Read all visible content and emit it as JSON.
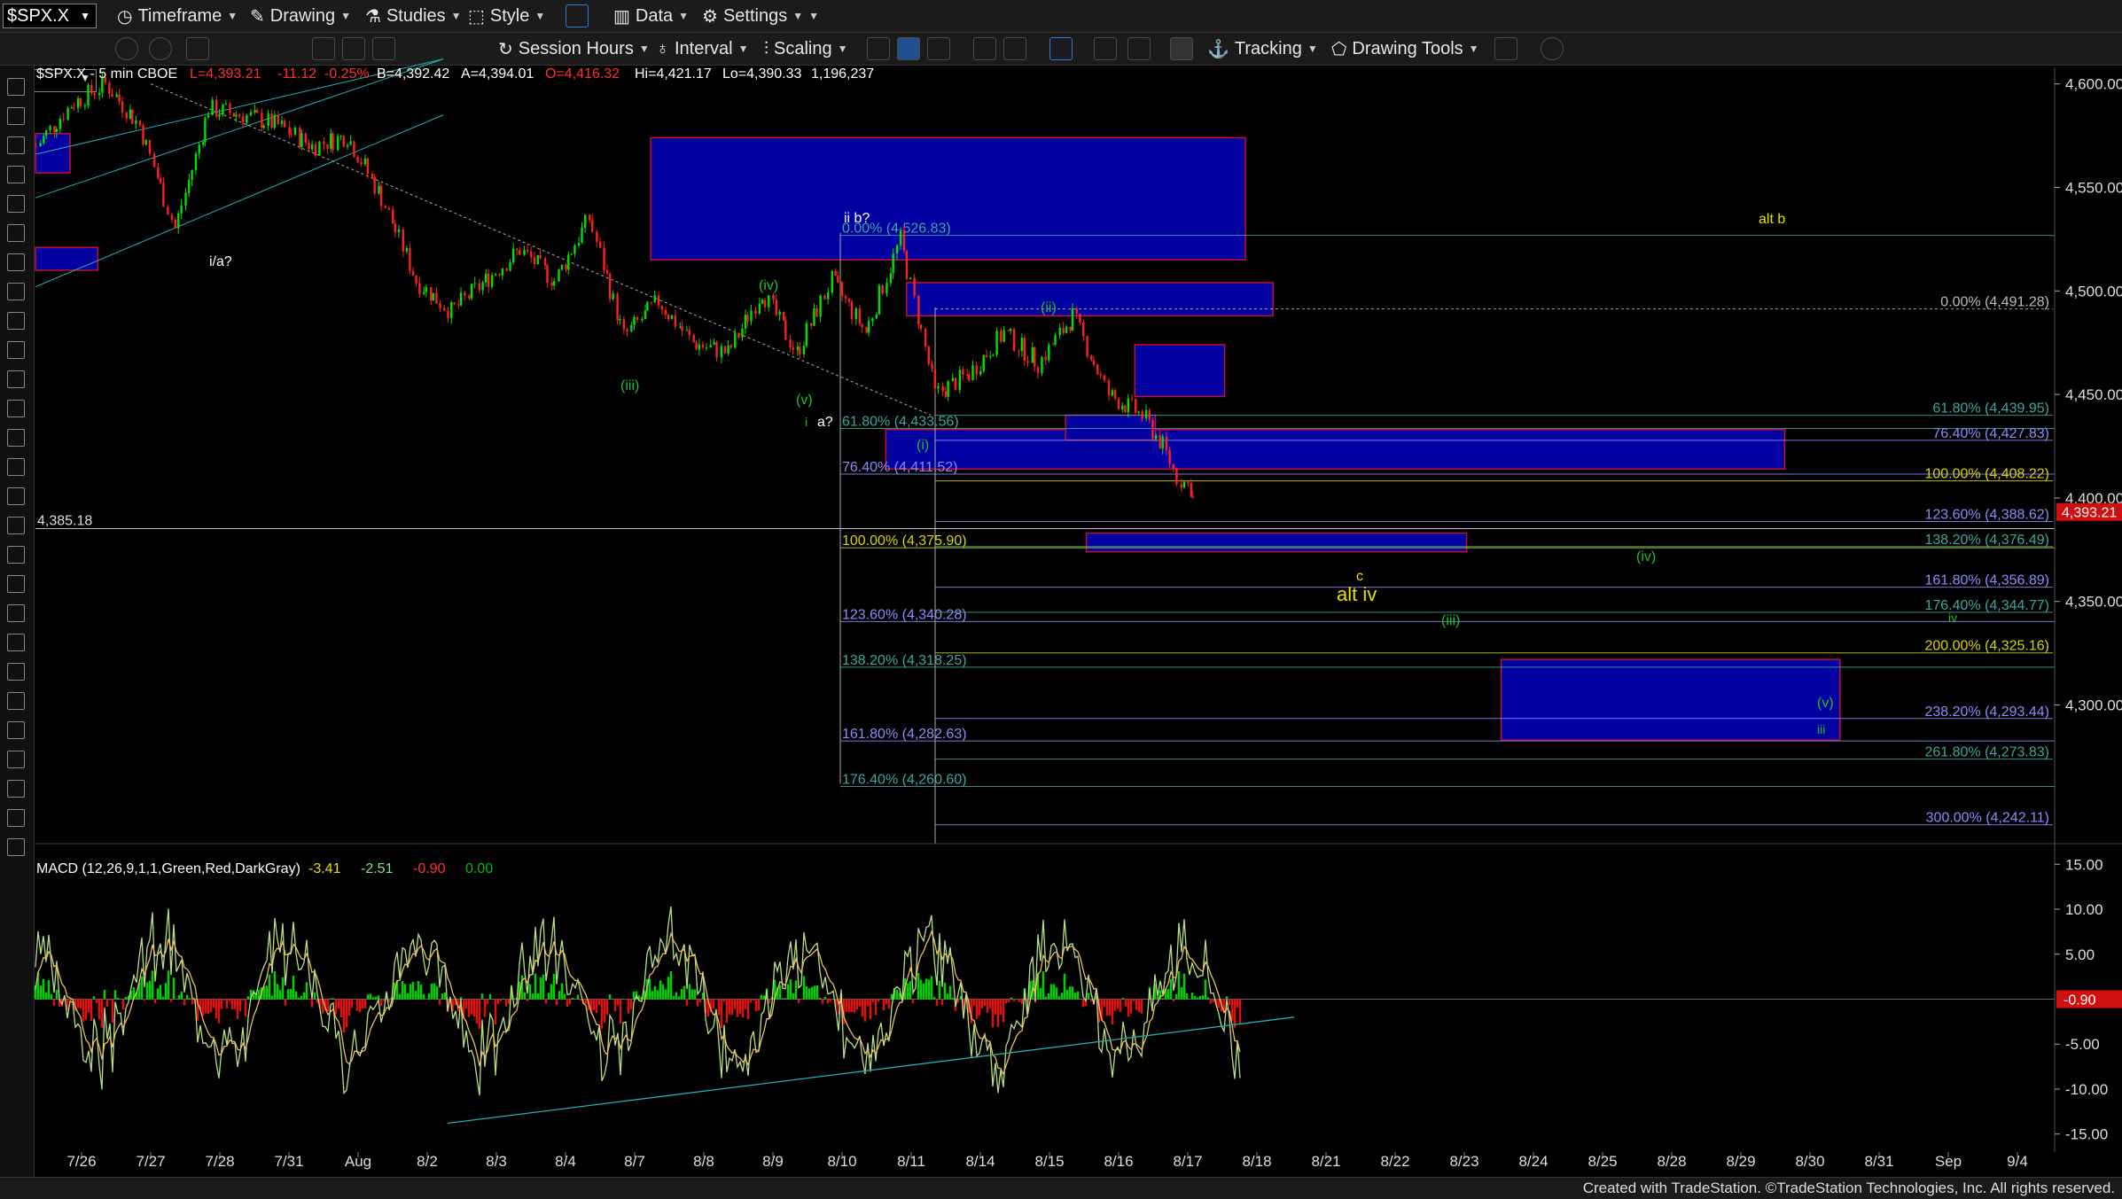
{
  "toolbar": {
    "symbol": "$SPX.X",
    "timeframe": "Timeframe",
    "drawing": "Drawing",
    "studies": "Studies",
    "style": "Style",
    "data": "Data",
    "settings": "Settings",
    "session_hours": "Session Hours",
    "interval": "Interval",
    "scaling": "Scaling",
    "tracking": "Tracking",
    "drawing_tools": "Drawing Tools"
  },
  "header": {
    "symbol_info": "$SPX.X - 5 min  CBOE",
    "last": "L=4,393.21",
    "change": "-11.12",
    "change_pct": "-0.25%",
    "bid": "B=4,392.42",
    "ask": "A=4,394.01",
    "open": "O=4,416.32",
    "high": "Hi=4,421.17",
    "low": "Lo=4,390.33",
    "volume": "1,196,237"
  },
  "colors": {
    "up": "#00e000",
    "down": "#ff2020",
    "box_fill": "#0000a0",
    "box_stroke": "#c0103a",
    "label_green": "#22c022",
    "label_yellow": "#e8e000",
    "fib_blue": "#8c8cff",
    "fib_teal": "#3aa89a",
    "fib_yellow": "#d6d600",
    "trend": "#20b0b0"
  },
  "chart_data": [
    {
      "type": "line",
      "title": "$SPX.X - 5 min",
      "x_ticks": [
        "7/26",
        "7/27",
        "7/28",
        "7/31",
        "Aug",
        "8/2",
        "8/3",
        "8/4",
        "8/7",
        "8/8",
        "8/9",
        "8/10",
        "8/11",
        "8/14",
        "8/15",
        "8/16",
        "8/17",
        "8/18",
        "8/21",
        "8/22",
        "8/23",
        "8/24",
        "8/25",
        "8/28",
        "8/29",
        "8/30",
        "8/31",
        "Sep",
        "9/4"
      ],
      "y_ticks": [
        "4,600.00",
        "4,550.00",
        "4,500.00",
        "4,450.00",
        "4,400.00",
        "4,350.00",
        "4,300.00"
      ],
      "ylim": [
        4233,
        4608
      ],
      "last_price": "4,393.21",
      "hline": "4,385.18",
      "x": [
        0,
        0.5,
        1,
        1.5,
        2,
        2.5,
        3,
        3.5,
        4,
        4.5,
        5,
        5.5,
        6,
        6.5,
        7,
        7.5,
        8,
        8.5,
        9,
        9.5,
        10,
        10.5,
        11,
        11.5,
        12,
        12.5,
        13,
        13.5,
        14,
        14.5,
        15,
        15.5,
        16,
        16.3,
        16.5,
        16.7,
        16.75
      ],
      "values": [
        4570,
        4590,
        4600,
        4580,
        4530,
        4588,
        4585,
        4580,
        4570,
        4575,
        4545,
        4505,
        4490,
        4505,
        4520,
        4505,
        4535,
        4478,
        4495,
        4475,
        4470,
        4500,
        4470,
        4505,
        4480,
        4525,
        4450,
        4460,
        4480,
        4465,
        4488,
        4450,
        4440,
        4425,
        4410,
        4405,
        4393
      ],
      "wave_labels": [
        "i/a?",
        "ii b?",
        "(iv)",
        "(iii)",
        "(v)",
        "i",
        "a?",
        "(i)",
        "(ii)",
        "(iv)",
        "(iii)",
        "c",
        "alt iv",
        "alt b",
        "(v)",
        "iii",
        "iv"
      ],
      "fib_labels": [
        "0.00% (4,526.83)",
        "61.80% (4,433.56)",
        "76.40% (4,411.52)",
        "100.00% (4,375.90)",
        "123.60% (4,340.28)",
        "138.20% (4,318.25)",
        "161.80% (4,282.63)",
        "176.40% (4,260.60)",
        "0.00% (4,491.28)",
        "61.80% (4,439.95)",
        "76.40% (4,427.83)",
        "100.00% (4,408.22)",
        "123.60% (4,388.62)",
        "138.20% (4,376.49)",
        "161.80% (4,356.89)",
        "176.40% (4,344.77)",
        "200.00% (4,325.16)",
        "238.20% (4,293.44)",
        "261.80% (4,273.83)",
        "300.00% (4,242.11)"
      ],
      "fib_values": [
        4526.83,
        4433.56,
        4411.52,
        4375.9,
        4340.28,
        4318.25,
        4282.63,
        4260.6,
        4491.28,
        4439.95,
        4427.83,
        4408.22,
        4388.62,
        4376.49,
        4356.89,
        4344.77,
        4325.16,
        4293.44,
        4273.83,
        4242.11
      ]
    },
    {
      "type": "line",
      "title": "MACD (12,26,9,1,1,Green,Red,DarkGray)",
      "values_text": [
        "-3.41",
        "-2.51",
        "-0.90",
        "0.00"
      ],
      "last_value": "-0.90",
      "y_ticks": [
        "15.00",
        "10.00",
        "5.00",
        "-5.00",
        "-10.00",
        "-15.00"
      ],
      "ylim": [
        -17,
        17
      ]
    }
  ],
  "footer": "Created with TradeStation. ©TradeStation Technologies, Inc. All rights reserved."
}
